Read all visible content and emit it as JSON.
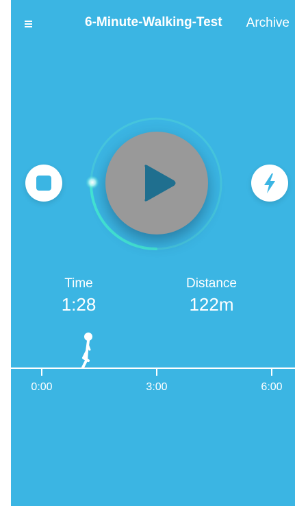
{
  "header": {
    "title": "6-Minute-Walking-Test",
    "archive_label": "Archive"
  },
  "icons": {
    "menu": "hamburger-menu-icon",
    "stop": "stop-icon",
    "play": "play-icon",
    "bolt": "lightning-bolt-icon",
    "walker": "walking-person-icon"
  },
  "stats": {
    "time_label": "Time",
    "time_value": "1:28",
    "distance_label": "Distance",
    "distance_value": "122m"
  },
  "timeline": {
    "ticks": [
      "0:00",
      "3:00",
      "6:00"
    ],
    "progress_fraction": 0.244
  },
  "colors": {
    "background": "#3bb5e3",
    "play_button": "#999999",
    "play_triangle": "#1f6f8f",
    "ring_progress": "#43e3d4",
    "ring_track": "#4fd0d8"
  }
}
